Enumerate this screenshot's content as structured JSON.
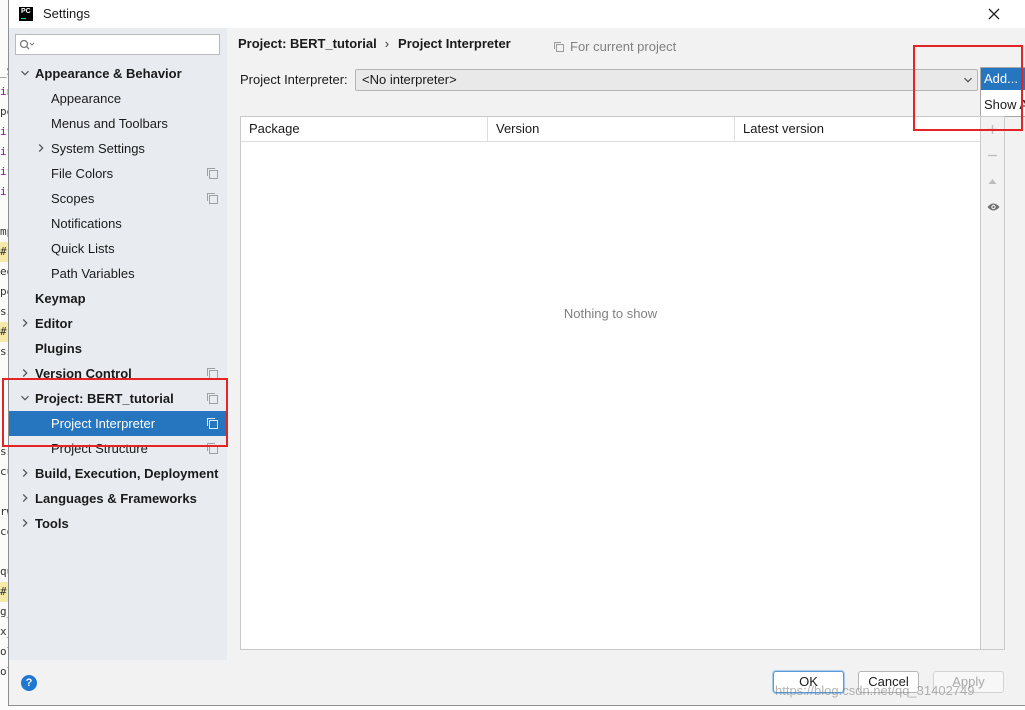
{
  "window": {
    "title": "Settings",
    "app_icon_text": "PC"
  },
  "colors": {
    "selection": "#2675bf",
    "sidebar_bg": "#e8ecf0",
    "panel_bg": "#f2f2f2",
    "annotation_red": "#e52525",
    "muted_text": "#808080",
    "disabled_text": "#a9a9a9",
    "keyword": "#871094",
    "highlight": "#f5eaa8"
  },
  "background_code": {
    "fragments": [
      {
        "text": "_S",
        "kind": "plain"
      },
      {
        "text": "in",
        "kind": "keyword"
      },
      {
        "text": "pe",
        "kind": "plain"
      },
      {
        "text": "if",
        "kind": "keyword"
      },
      {
        "text": "if",
        "kind": "keyword"
      },
      {
        "text": "if",
        "kind": "keyword"
      },
      {
        "text": "if",
        "kind": "keyword"
      },
      {
        "text": "mp",
        "kind": "plain"
      },
      {
        "text": "#",
        "kind": "highlight"
      },
      {
        "text": "ed",
        "kind": "plain"
      },
      {
        "text": "pe",
        "kind": "plain"
      },
      {
        "text": "si",
        "kind": "plain"
      },
      {
        "text": "#",
        "kind": "highlight"
      },
      {
        "text": "ss",
        "kind": "plain"
      },
      {
        "text": "ss",
        "kind": "plain"
      },
      {
        "text": "cu",
        "kind": "plain"
      },
      {
        "text": "rw",
        "kind": "plain"
      },
      {
        "text": "co",
        "kind": "plain"
      },
      {
        "text": "qu",
        "kind": "plain"
      },
      {
        "text": "#",
        "kind": "highlight"
      },
      {
        "text": "g_",
        "kind": "plain"
      },
      {
        "text": "x_",
        "kind": "plain"
      },
      {
        "text": "ol",
        "kind": "plain"
      },
      {
        "text": "ol",
        "kind": "plain"
      }
    ]
  },
  "sidebar": {
    "items": [
      {
        "label": "Appearance & Behavior",
        "level": 0,
        "bold": true,
        "expander": "expanded"
      },
      {
        "label": "Appearance",
        "level": 1
      },
      {
        "label": "Menus and Toolbars",
        "level": 1
      },
      {
        "label": "System Settings",
        "level": 1,
        "expander": "collapsed"
      },
      {
        "label": "File Colors",
        "level": 1,
        "project_level_icon": true
      },
      {
        "label": "Scopes",
        "level": 1,
        "project_level_icon": true
      },
      {
        "label": "Notifications",
        "level": 1
      },
      {
        "label": "Quick Lists",
        "level": 1
      },
      {
        "label": "Path Variables",
        "level": 1
      },
      {
        "label": "Keymap",
        "level": 0,
        "bold": true
      },
      {
        "label": "Editor",
        "level": 0,
        "bold": true,
        "expander": "collapsed"
      },
      {
        "label": "Plugins",
        "level": 0,
        "bold": true
      },
      {
        "label": "Version Control",
        "level": 0,
        "bold": true,
        "expander": "collapsed",
        "project_level_icon": true
      },
      {
        "label": "Project: BERT_tutorial",
        "level": 0,
        "bold": true,
        "expander": "expanded",
        "project_level_icon": true
      },
      {
        "label": "Project Interpreter",
        "level": 1,
        "selected": true,
        "project_level_icon": true
      },
      {
        "label": "Project Structure",
        "level": 1,
        "project_level_icon": true
      },
      {
        "label": "Build, Execution, Deployment",
        "level": 0,
        "bold": true,
        "expander": "collapsed"
      },
      {
        "label": "Languages & Frameworks",
        "level": 0,
        "bold": true,
        "expander": "collapsed"
      },
      {
        "label": "Tools",
        "level": 0,
        "bold": true,
        "expander": "collapsed"
      }
    ]
  },
  "breadcrumb": {
    "parent": "Project: BERT_tutorial",
    "separator": "›",
    "current": "Project Interpreter"
  },
  "scope_hint": {
    "icon": "copy-icon",
    "label": "For current project"
  },
  "interpreter": {
    "label": "Project Interpreter:",
    "value": "<No interpreter>"
  },
  "add_menu": {
    "items": [
      {
        "label": "Add...",
        "highlighted": true
      },
      {
        "label": "Show A",
        "highlighted": false
      }
    ]
  },
  "packages_table": {
    "columns": [
      "Package",
      "Version",
      "Latest version"
    ],
    "rows": [],
    "empty_text": "Nothing to show"
  },
  "table_toolbar": [
    {
      "icon": "plus-icon",
      "enabled": false
    },
    {
      "icon": "minus-icon",
      "enabled": false
    },
    {
      "icon": "triangle-up-icon",
      "enabled": false
    },
    {
      "icon": "eye-icon",
      "enabled": true
    }
  ],
  "footer": {
    "help_glyph": "?",
    "ok_label": "OK",
    "cancel_label": "Cancel",
    "apply_label": "Apply",
    "apply_enabled": false
  },
  "watermark": "https://blog.csdn.net/qq_31402749"
}
